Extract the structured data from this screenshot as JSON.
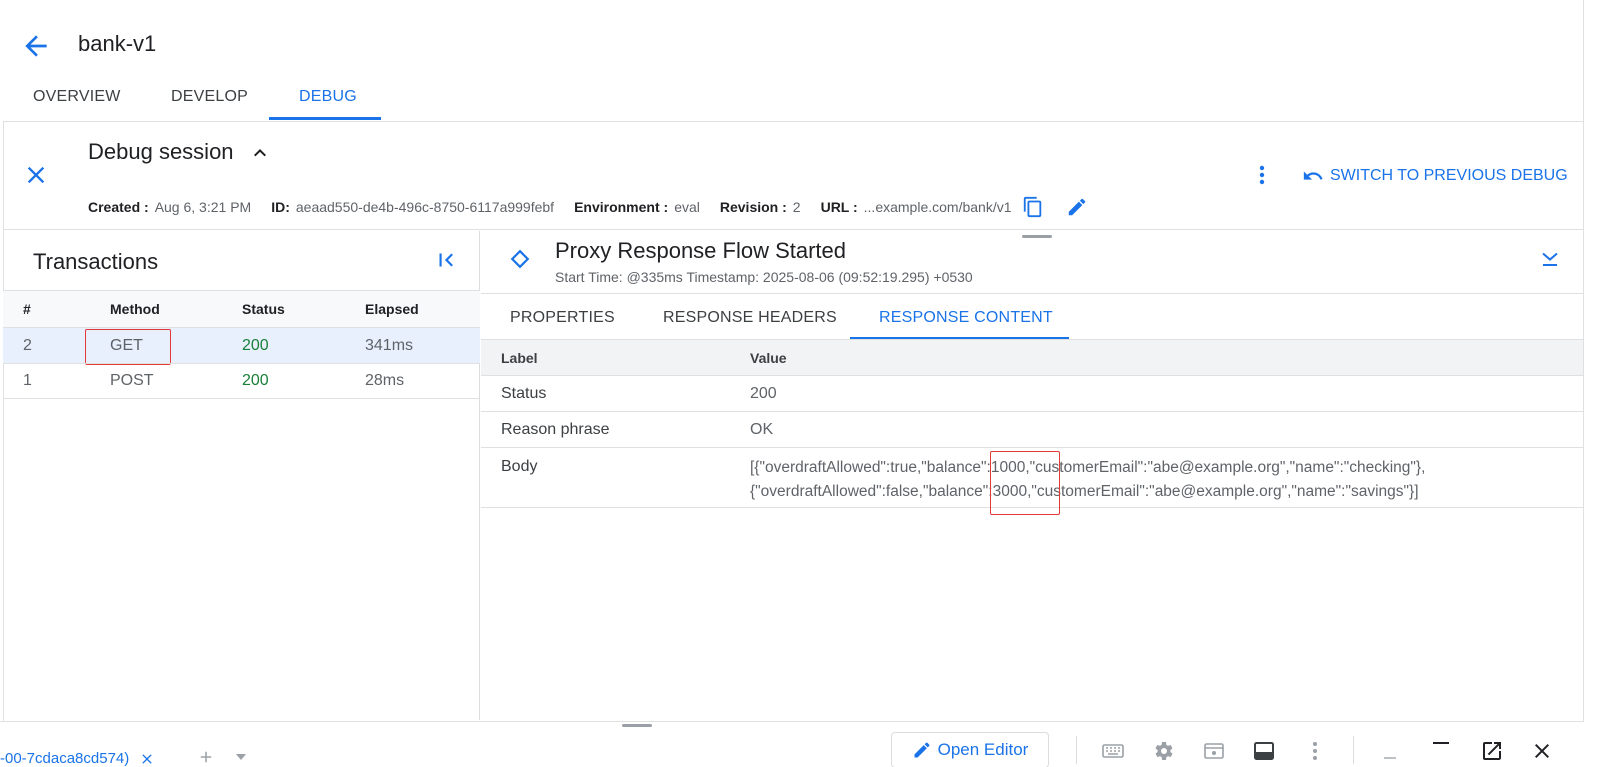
{
  "app": {
    "title": "bank-v1"
  },
  "tabs": [
    "OVERVIEW",
    "DEVELOP",
    "DEBUG"
  ],
  "session": {
    "title": "Debug session",
    "created_label": "Created :",
    "created_value": "Aug 6, 3:21 PM",
    "id_label": "ID:",
    "id_value": "aeaad550-de4b-496c-8750-6117a999febf",
    "env_label": "Environment :",
    "env_value": "eval",
    "rev_label": "Revision :",
    "rev_value": "2",
    "url_label": "URL :",
    "url_value": "...example.com/bank/v1",
    "switch_label": "SWITCH TO PREVIOUS DEBUG"
  },
  "transactions": {
    "title": "Transactions",
    "columns": [
      "#",
      "Method",
      "Status",
      "Elapsed"
    ],
    "rows": [
      {
        "num": "2",
        "method": "GET",
        "status": "200",
        "elapsed": "341ms"
      },
      {
        "num": "1",
        "method": "POST",
        "status": "200",
        "elapsed": "28ms"
      }
    ]
  },
  "detail": {
    "title": "Proxy Response Flow Started",
    "subtitle": "Start Time: @335ms Timestamp: 2025-08-06 (09:52:19.295) +0530",
    "tabs": [
      "PROPERTIES",
      "RESPONSE HEADERS",
      "RESPONSE CONTENT"
    ],
    "columns": [
      "Label",
      "Value"
    ],
    "rows": [
      {
        "label": "Status",
        "value": "200"
      },
      {
        "label": "Reason phrase",
        "value": "OK"
      },
      {
        "label": "Body",
        "value_line1": "[{\"overdraftAllowed\":true,\"balance\":1000,\"customerEmail\":\"abe@example.org\",\"name\":\"checking\"},",
        "value_line2": "{\"overdraftAllowed\":false,\"balance\":3000,\"customerEmail\":\"abe@example.org\",\"name\":\"savings\"}]"
      }
    ]
  },
  "bottom_bar": {
    "tab_label": "-00-7cdaca8cd574)",
    "open_editor_label": "Open Editor"
  },
  "colors": {
    "accent": "#1a73e8",
    "success": "#188038",
    "highlight": "#e53935"
  }
}
